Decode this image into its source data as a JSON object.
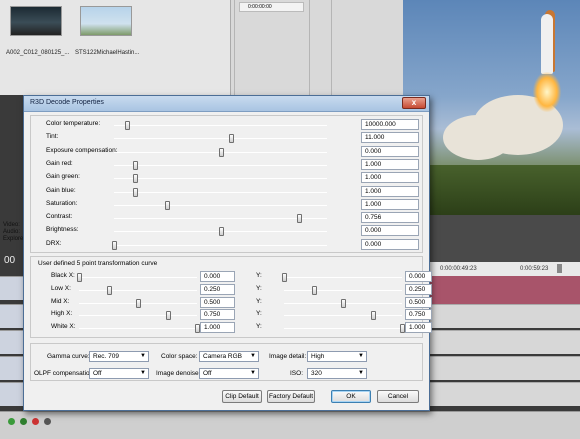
{
  "media": {
    "clip1_name": "A002_C012_080125_...",
    "clip2_name": "STS122MichaelHastin..."
  },
  "trimmer": {
    "timecode": "0:00:00:00"
  },
  "timeline": {
    "ruler": [
      "0:00:00:49:23",
      "0:00:59:23"
    ],
    "side_labels": [
      "Video:",
      "Audio:",
      "Explorer"
    ],
    "time_big": "00"
  },
  "dialog": {
    "title": "R3D Decode Properties",
    "close_glyph": "x",
    "sliders": [
      {
        "label": "Color temperature:",
        "value": "10000.000",
        "pos": 0.06
      },
      {
        "label": "Tint:",
        "value": "11.000",
        "pos": 0.55
      },
      {
        "label": "Exposure compensation:",
        "value": "0.000",
        "pos": 0.5
      },
      {
        "label": "Gain red:",
        "value": "1.000",
        "pos": 0.1
      },
      {
        "label": "Gain green:",
        "value": "1.000",
        "pos": 0.1
      },
      {
        "label": "Gain blue:",
        "value": "1.000",
        "pos": 0.1
      },
      {
        "label": "Saturation:",
        "value": "1.000",
        "pos": 0.25
      },
      {
        "label": "Contrast:",
        "value": "0.756",
        "pos": 0.87
      },
      {
        "label": "Brightness:",
        "value": "0.000",
        "pos": 0.5
      },
      {
        "label": "DRX:",
        "value": "0.000",
        "pos": 0.0
      }
    ],
    "curve_title": "User defined 5 point transformation curve",
    "curve_x": [
      {
        "label": "Black X:",
        "value": "0.000",
        "pos": 0.0
      },
      {
        "label": "Low X:",
        "value": "0.250",
        "pos": 0.25
      },
      {
        "label": "Mid X:",
        "value": "0.500",
        "pos": 0.5
      },
      {
        "label": "High X:",
        "value": "0.750",
        "pos": 0.75
      },
      {
        "label": "White X:",
        "value": "1.000",
        "pos": 1.0
      }
    ],
    "curve_y": [
      {
        "label": "Y:",
        "value": "0.000",
        "pos": 0.0
      },
      {
        "label": "Y:",
        "value": "0.250",
        "pos": 0.25
      },
      {
        "label": "Y:",
        "value": "0.500",
        "pos": 0.5
      },
      {
        "label": "Y:",
        "value": "0.750",
        "pos": 0.75
      },
      {
        "label": "Y:",
        "value": "1.000",
        "pos": 1.0
      }
    ],
    "gamma_curve": {
      "label": "Gamma curve:",
      "value": "Rec. 709"
    },
    "color_space": {
      "label": "Color space:",
      "value": "Camera RGB"
    },
    "image_detail": {
      "label": "Image detail:",
      "value": "High"
    },
    "olpf": {
      "label": "OLPF compensation:",
      "value": "Off"
    },
    "image_denoise": {
      "label": "Image denoise:",
      "value": "Off"
    },
    "iso": {
      "label": "ISO:",
      "value": "320"
    },
    "buttons": {
      "clip_default": "Clip Default",
      "factory_default": "Factory Default",
      "ok": "OK",
      "cancel": "Cancel"
    }
  }
}
